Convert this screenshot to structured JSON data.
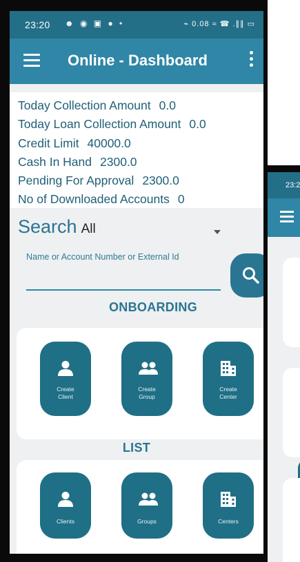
{
  "status_bar": {
    "time": "23:20",
    "notification_icons": "☻ ◉ ▣ ● •",
    "network_indicator": "⌁ 0.08 ≈ ☎ .∥∥ ▭"
  },
  "app_bar": {
    "title": "Online - Dashboard"
  },
  "summary": {
    "rows": [
      {
        "label": "Today Collection Amount",
        "value": "0.0"
      },
      {
        "label": "Today Loan Collection Amount",
        "value": "0.0"
      },
      {
        "label": "Credit Limit",
        "value": "40000.0"
      },
      {
        "label": "Cash In Hand",
        "value": "2300.0"
      },
      {
        "label": "Pending For Approval",
        "value": "2300.0"
      },
      {
        "label": "No of Downloaded Accounts",
        "value": "0"
      }
    ]
  },
  "search": {
    "label": "Search",
    "selected": "All",
    "placeholder": "Name or Account Number or External Id"
  },
  "onboarding": {
    "title": "ONBOARDING",
    "tiles": [
      {
        "line1": "Create",
        "line2": "Client",
        "icon": "person-icon"
      },
      {
        "line1": "Create",
        "line2": "Group",
        "icon": "group-icon"
      },
      {
        "line1": "Create",
        "line2": "Center",
        "icon": "building-icon"
      }
    ]
  },
  "list": {
    "title": "LIST",
    "tiles": [
      {
        "label": "Clients",
        "icon": "person-icon"
      },
      {
        "label": "Groups",
        "icon": "group-icon"
      },
      {
        "label": "Centers",
        "icon": "building-icon"
      }
    ]
  },
  "background_phone": {
    "status_time": "23:2"
  },
  "colors": {
    "primary": "#2f86a6",
    "primary_dark": "#246f88",
    "tile": "#1f6f86",
    "text_accent": "#1f5f78",
    "background": "#eef0f1"
  }
}
